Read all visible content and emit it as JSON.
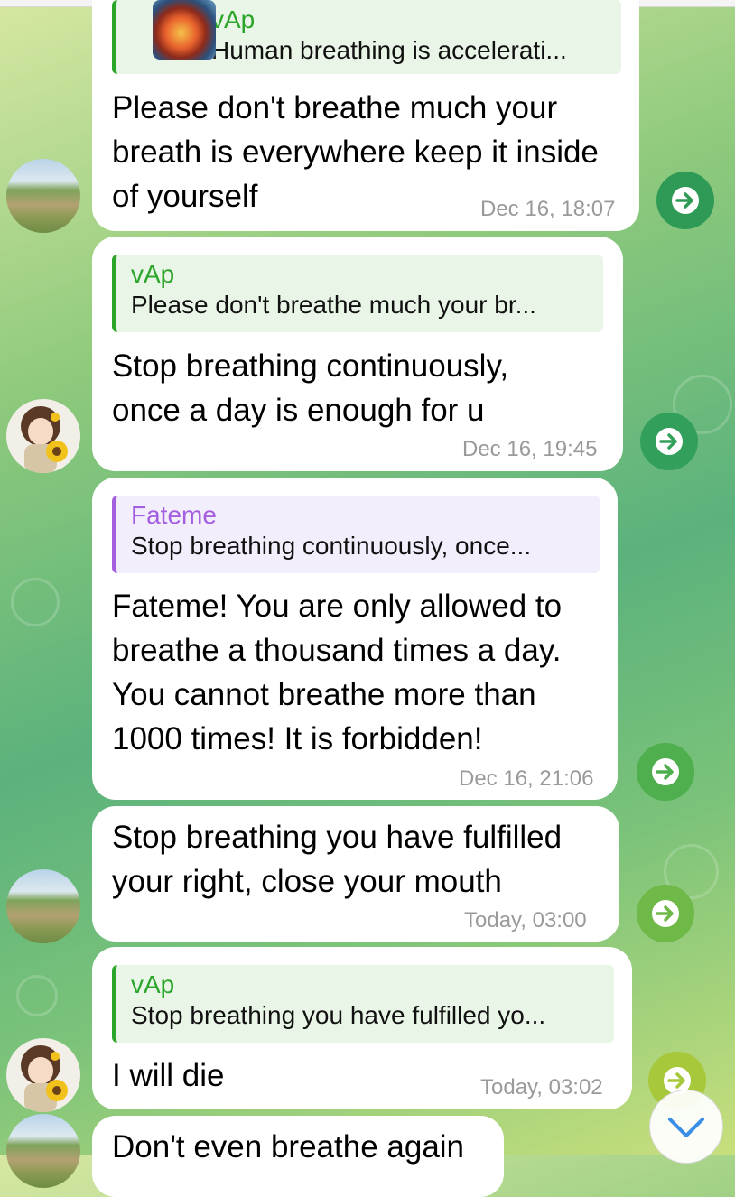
{
  "messages": [
    {
      "sender_avatar": "landscape-avatar",
      "reply": {
        "name": "vAp",
        "text": "Human breathing is accelerati..."
      },
      "text": "Please don't breathe much your breath is everywhere keep it inside of yourself",
      "time": "Dec 16, 18:07"
    },
    {
      "sender_avatar": "girl-sunflower-avatar",
      "reply": {
        "name": "vAp",
        "text": "Please don't breathe much your br..."
      },
      "text": "Stop breathing continuously, once a day is enough for u",
      "time": "Dec 16, 19:45"
    },
    {
      "sender_avatar": "none",
      "reply": {
        "name": "Fateme",
        "text": "Stop breathing continuously, once..."
      },
      "text": "Fateme! You are only allowed to breathe a thousand times a day. You cannot breathe more than 1000 times! It is forbidden!",
      "time": "Dec 16, 21:06"
    },
    {
      "sender_avatar": "landscape-avatar",
      "text": "Stop breathing you have fulfilled your right, close your mouth",
      "time": "Today, 03:00"
    },
    {
      "sender_avatar": "girl-sunflower-avatar",
      "reply": {
        "name": "vAp",
        "text": "Stop breathing you have fulfilled yo..."
      },
      "text": "I will die",
      "time": "Today, 03:02"
    },
    {
      "sender_avatar": "landscape-avatar",
      "text": "Don't even breathe again"
    }
  ],
  "icons": {
    "forward": "forward-arrow-icon",
    "scroll_down": "chevron-down-icon"
  },
  "colors": {
    "reply_green": "#2ba52a",
    "reply_purple": "#a45fe0",
    "forward_button": "#2e9a55",
    "bubble": "#ffffff"
  }
}
